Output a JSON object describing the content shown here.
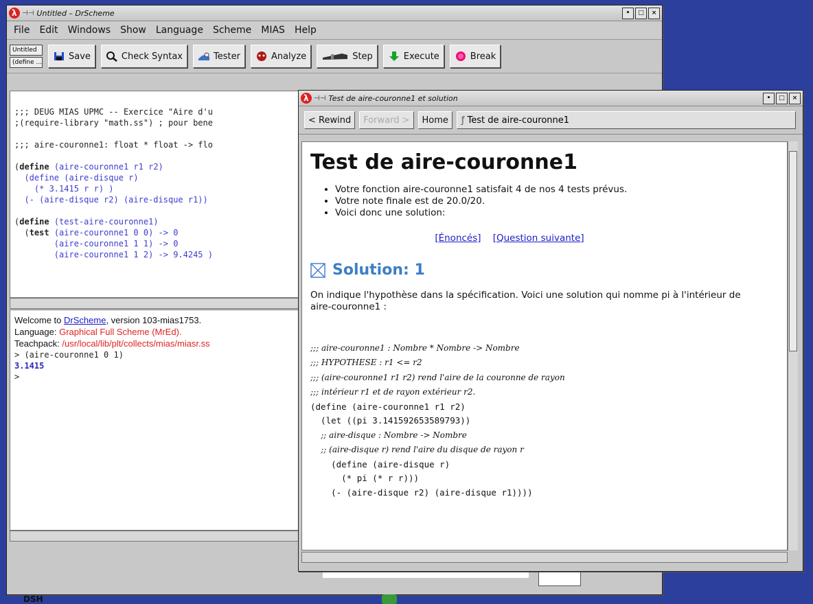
{
  "main_window": {
    "title": "Untitled – DrScheme",
    "menus": [
      "File",
      "Edit",
      "Windows",
      "Show",
      "Language",
      "Scheme",
      "MIAS",
      "Help"
    ],
    "mini_buttons": [
      "Untitled",
      "(define ...)"
    ],
    "toolbar": {
      "save": "Save",
      "check_syntax": "Check Syntax",
      "tester": "Tester",
      "analyze": "Analyze",
      "step": "Step",
      "execute": "Execute",
      "break": "Break"
    },
    "definitions": {
      "line1": ";;; DEUG MIAS UPMC -- Exercice \"Aire d'u",
      "line2": ";(require-library \"math.ss\") ; pour bene",
      "line3": ";;; aire-couronne1: float * float -> flo",
      "define_kw": "define",
      "line4_name": "(aire-couronne1 r1 r2)",
      "line5": "  (define (aire-disque r)",
      "line6": "    (* 3.1415 r r) )",
      "line7": "  (- (aire-disque r2) (aire-disque r1))",
      "line8_name": "(test-aire-couronne1)",
      "test_kw": "test",
      "t1": "(aire-couronne1 0 0) -> 0",
      "t2": "(aire-couronne1 1 1) -> 0",
      "t3": "(aire-couronne1 1 2) -> 9.4245 )"
    },
    "repl": {
      "welcome_prefix": "Welcome to ",
      "welcome_link": "DrScheme",
      "welcome_suffix": ", version 103-mias1753.",
      "language_label": "Language: ",
      "language_value": "Graphical Full Scheme (MrEd).",
      "teachpack_label": "Teachpack: ",
      "teachpack_value": "/usr/local/lib/plt/collects/mias/miasr.ss",
      "input": "> (aire-couronne1 0 1)",
      "output": "3.1415",
      "prompt": ">"
    }
  },
  "help_window": {
    "title": "Test de aire-couronne1 et solution",
    "nav": {
      "rewind": "< Rewind",
      "forward": "Forward >",
      "home": "Home",
      "location": "Test de aire-couronne1"
    },
    "heading": "Test de aire-couronne1",
    "bullets": [
      "Votre fonction aire-couronne1 satisfait 4 de nos 4 tests prévus.",
      "Votre note finale est de 20.0/20.",
      "Voici donc une solution:"
    ],
    "links": [
      "[Énoncés]",
      "[Question suivante]"
    ],
    "solution_heading": "Solution: 1",
    "intro_text": "On indique l'hypothèse dans la spécification. Voici une solution qui nomme pi à l'intérieur de aire-couronne1 :",
    "code": [
      {
        "text": ";;; aire-couronne1 : Nombre * Nombre -> Nombre",
        "style": "it"
      },
      {
        "text": ";;; HYPOTHESE : r1 <= r2",
        "style": "it"
      },
      {
        "text": ";;; (aire-couronne1 r1 r2) rend l'aire de la couronne de rayon",
        "style": "it"
      },
      {
        "text": ";;; intérieur r1 et de rayon extérieur r2.",
        "style": "it"
      },
      {
        "text": "(define (aire-couronne1 r1 r2)",
        "style": "mono"
      },
      {
        "text": "  (let ((pi 3.141592653589793))",
        "style": "mono"
      },
      {
        "text": "    ;; aire-disque : Nombre -> Nombre",
        "style": "it"
      },
      {
        "text": "    ;; (aire-disque r) rend l'aire du disque de rayon r",
        "style": "it"
      },
      {
        "text": "    (define (aire-disque r)",
        "style": "mono"
      },
      {
        "text": "      (* pi (* r r)))",
        "style": "mono"
      },
      {
        "text": "    (- (aire-disque r2) (aire-disque r1))))",
        "style": "mono"
      }
    ]
  },
  "desktop": {
    "taskbar_label": "DSH"
  }
}
